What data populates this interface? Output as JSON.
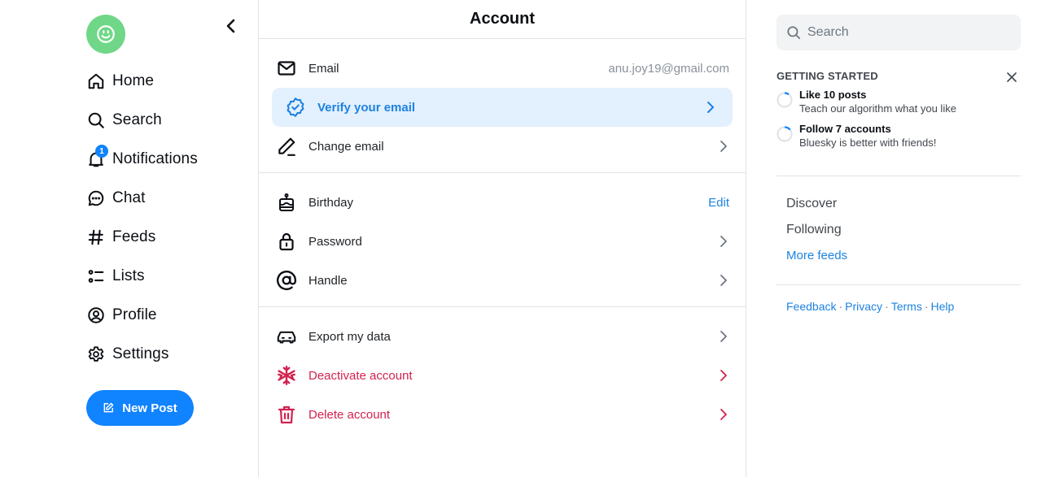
{
  "nav": {
    "avatar_icon": "smiley-face-icon",
    "collapse_icon": "chevron-left-icon",
    "items": [
      {
        "label": "Home",
        "icon": "home-icon"
      },
      {
        "label": "Search",
        "icon": "search-icon"
      },
      {
        "label": "Notifications",
        "icon": "bell-icon",
        "badge": "1"
      },
      {
        "label": "Chat",
        "icon": "chat-bubble-icon"
      },
      {
        "label": "Feeds",
        "icon": "hashtag-icon"
      },
      {
        "label": "Lists",
        "icon": "list-icon"
      },
      {
        "label": "Profile",
        "icon": "user-circle-icon"
      },
      {
        "label": "Settings",
        "icon": "gear-icon"
      }
    ],
    "new_post_label": "New Post"
  },
  "main": {
    "title": "Account",
    "email": {
      "label": "Email",
      "value": "anu.joy19@gmail.com"
    },
    "verify_email": {
      "label": "Verify your email"
    },
    "change_email": {
      "label": "Change email"
    },
    "birthday": {
      "label": "Birthday",
      "action": "Edit"
    },
    "password": {
      "label": "Password"
    },
    "handle": {
      "label": "Handle"
    },
    "export_data": {
      "label": "Export my data"
    },
    "deactivate": {
      "label": "Deactivate account"
    },
    "delete": {
      "label": "Delete account"
    }
  },
  "sidebar": {
    "search_placeholder": "Search",
    "getting_started": {
      "title": "GETTING STARTED",
      "tasks": [
        {
          "title": "Like 10 posts",
          "subtitle": "Teach our algorithm what you like",
          "progress": 0.1
        },
        {
          "title": "Follow 7 accounts",
          "subtitle": "Bluesky is better with friends!",
          "progress": 0.14
        }
      ]
    },
    "feeds": [
      "Discover",
      "Following"
    ],
    "more_feeds": "More feeds",
    "footer_links": [
      "Feedback",
      "Privacy",
      "Terms",
      "Help"
    ],
    "footer_separator": "·"
  },
  "colors": {
    "accent": "#1083fe",
    "link": "#1d82e0",
    "danger": "#d2224f",
    "avatar": "#6fd787",
    "verify_bg": "#e3f0fd"
  }
}
